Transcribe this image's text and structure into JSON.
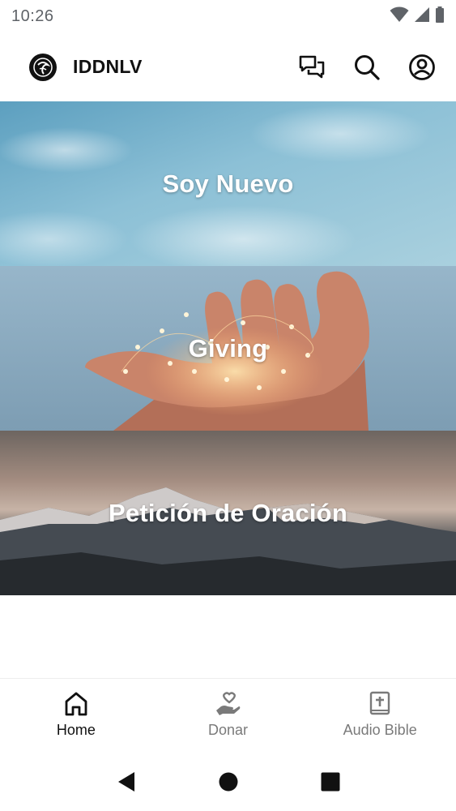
{
  "status_bar": {
    "time": "10:26",
    "icons": [
      "wifi-icon",
      "cell-signal-icon",
      "battery-icon"
    ]
  },
  "app_bar": {
    "title": "IDDNLV",
    "logo_icon": "church-logo-icon",
    "actions": [
      {
        "name": "chat-button",
        "icon": "chat-bubbles-icon"
      },
      {
        "name": "search-button",
        "icon": "search-icon"
      },
      {
        "name": "profile-button",
        "icon": "account-circle-icon"
      }
    ]
  },
  "cards": [
    {
      "label": "Soy Nuevo"
    },
    {
      "label": "Giving"
    },
    {
      "label": "Petición de Oración"
    }
  ],
  "bottom_nav": {
    "items": [
      {
        "label": "Home",
        "icon": "home-icon",
        "active": true
      },
      {
        "label": "Donar",
        "icon": "donate-heart-hand-icon",
        "active": false
      },
      {
        "label": "Audio Bible",
        "icon": "bible-icon",
        "active": false
      }
    ]
  },
  "system_nav": {
    "buttons": [
      "back-icon",
      "home-circle-icon",
      "recents-square-icon"
    ]
  },
  "colors": {
    "text_primary": "#111111",
    "text_inactive": "#7a7a7a",
    "status_gray": "#5f6368"
  }
}
